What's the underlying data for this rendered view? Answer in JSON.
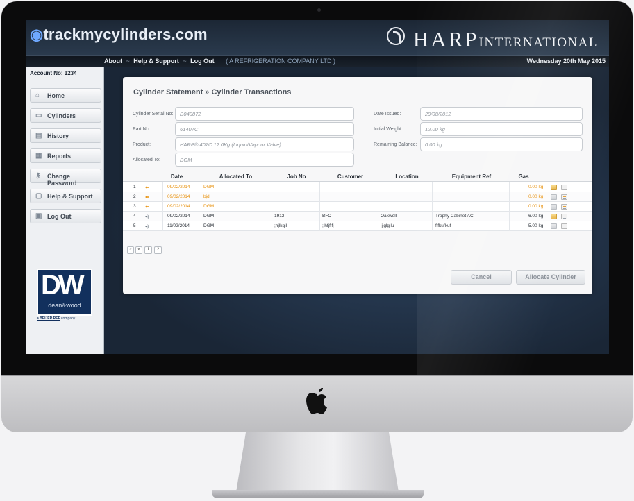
{
  "header": {
    "brand": "trackmycylinders.com",
    "partner_main": "HARP",
    "partner_sub": "INTERNATIONAL"
  },
  "nav": {
    "about": "About",
    "help": "Help & Support",
    "logout": "Log Out",
    "separator": "~",
    "company": "( A REFRIGERATION COMPANY LTD )",
    "date": "Wednesday 20th May 2015"
  },
  "sidebar": {
    "account": "Account No: 1234",
    "items": [
      {
        "label": "Home",
        "icon": "home-icon",
        "glyph": "⌂"
      },
      {
        "label": "Cylinders",
        "icon": "cylinder-icon",
        "glyph": "▭"
      },
      {
        "label": "History",
        "icon": "history-icon",
        "glyph": "▤"
      },
      {
        "label": "Reports",
        "icon": "report-icon",
        "glyph": "▦"
      },
      {
        "label": "Change Password",
        "icon": "key-icon",
        "glyph": "⚷"
      },
      {
        "label": "Help & Support",
        "icon": "help-icon",
        "glyph": "▢"
      },
      {
        "label": "Log Out",
        "icon": "lock-icon",
        "glyph": "▣"
      }
    ],
    "partner": {
      "big": "DW",
      "small": "dean&wood",
      "tag_brand": "a BEIJER REF",
      "tag_rest": " company"
    }
  },
  "panel": {
    "title": "Cylinder Statement » Cylinder Transactions",
    "fields": {
      "serial": {
        "label": "Cylinder Serial No:",
        "value": "D040872"
      },
      "part": {
        "label": "Part No:",
        "value": "61407C"
      },
      "product": {
        "label": "Product:",
        "value": "HARP® 407C 12.0Kg (Liquid/Vapour Valve)"
      },
      "allocated": {
        "label": "Allocated To:",
        "value": "DGM"
      },
      "date_issued": {
        "label": "Date Issued:",
        "value": "29/08/2012"
      },
      "initial_weight": {
        "label": "Initial Weight:",
        "value": "12.00 kg"
      },
      "remaining": {
        "label": "Remaining Balance:",
        "value": "0.00 kg"
      }
    },
    "columns": [
      "Date",
      "Allocated To",
      "Job No",
      "Customer",
      "Location",
      "Equipment Ref",
      "Gas"
    ],
    "rows": [
      {
        "n": "1",
        "glyph": "⬅",
        "date": "09/02/2014",
        "alloc": "DGM",
        "job": "",
        "customer": "",
        "location": "",
        "equip": "",
        "gas": "0.00 kg",
        "style": "orange"
      },
      {
        "n": "2",
        "glyph": "⬅",
        "date": "09/02/2014",
        "alloc": "bjd",
        "job": "",
        "customer": "",
        "location": "",
        "equip": "",
        "gas": "0.00 kg",
        "style": "orange"
      },
      {
        "n": "3",
        "glyph": "⬅",
        "date": "09/02/2014",
        "alloc": "DGM",
        "job": "",
        "customer": "",
        "location": "",
        "equip": "",
        "gas": "0.00 kg",
        "style": "orange"
      },
      {
        "n": "4",
        "glyph": "◂)",
        "date": "09/02/2014",
        "alloc": "DGM",
        "job": "1912",
        "customer": "BFC",
        "location": "Oakwell",
        "equip": "Trophy Cabinet AC",
        "gas": "6.00 kg",
        "style": "normal"
      },
      {
        "n": "5",
        "glyph": "◂)",
        "date": "11/02/2014",
        "alloc": "DGM",
        "job": ";hjlkgil",
        "customer": ";jhfjfjfj",
        "location": "ljjglgilu",
        "equip": "fjfkufkuf",
        "gas": "5.00 kg",
        "style": "normal"
      }
    ],
    "pager": [
      "«",
      "»",
      "1",
      "2"
    ],
    "cancel": "Cancel",
    "allocate": "Allocate Cylinder"
  }
}
